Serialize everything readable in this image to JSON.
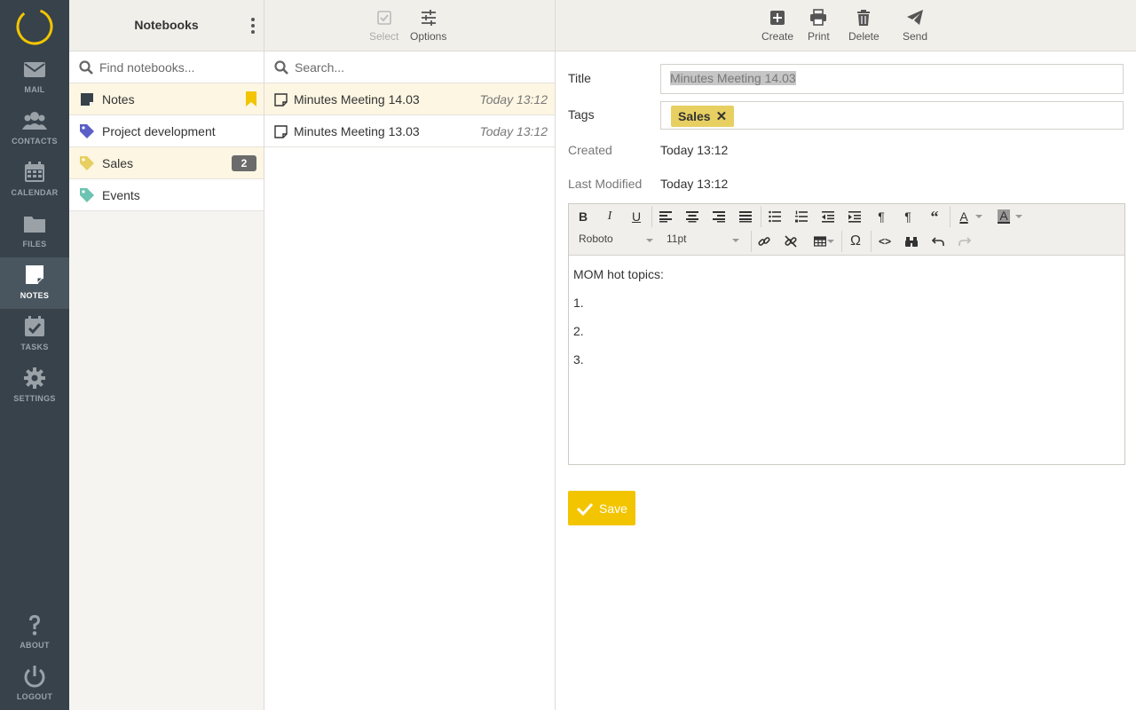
{
  "nav": {
    "items": [
      {
        "label": "MAIL",
        "icon": "mail-icon"
      },
      {
        "label": "CONTACTS",
        "icon": "contacts-icon"
      },
      {
        "label": "CALENDAR",
        "icon": "calendar-icon"
      },
      {
        "label": "FILES",
        "icon": "folder-icon"
      },
      {
        "label": "NOTES",
        "icon": "note-icon"
      },
      {
        "label": "TASKS",
        "icon": "tasks-icon"
      },
      {
        "label": "SETTINGS",
        "icon": "gear-icon"
      }
    ],
    "bottom": [
      {
        "label": "ABOUT",
        "icon": "question-icon"
      },
      {
        "label": "LOGOUT",
        "icon": "power-icon"
      }
    ],
    "active": "NOTES"
  },
  "notebooks": {
    "title": "Notebooks",
    "search_placeholder": "Find notebooks...",
    "items": [
      {
        "name": "Notes",
        "color": "#37424b"
      },
      {
        "name": "Project development",
        "color": "#5b5fc7"
      },
      {
        "name": "Sales",
        "color": "#e7cf62",
        "count": "2"
      },
      {
        "name": "Events",
        "color": "#6cc3b2"
      }
    ]
  },
  "noteslist": {
    "toolbar": {
      "select_label": "Select",
      "options_label": "Options"
    },
    "search_placeholder": "Search...",
    "notes": [
      {
        "title": "Minutes Meeting 14.03",
        "date": "Today 13:12"
      },
      {
        "title": "Minutes Meeting 13.03",
        "date": "Today 13:12"
      }
    ]
  },
  "detail": {
    "toolbar": {
      "create_label": "Create",
      "print_label": "Print",
      "delete_label": "Delete",
      "send_label": "Send"
    },
    "form": {
      "title_label": "Title",
      "title_value": "Minutes Meeting 14.03",
      "tags_label": "Tags",
      "tag": "Sales",
      "created_label": "Created",
      "created_value": "Today 13:12",
      "modified_label": "Last Modified",
      "modified_value": "Today 13:12"
    },
    "editor": {
      "font": "Roboto",
      "size": "11pt",
      "lines": [
        "MOM hot topics:",
        "1.",
        "2.",
        "3."
      ]
    },
    "save_label": "Save"
  },
  "colors": {
    "accent": "#f2c500",
    "nav_bg": "#37424b",
    "tag": "#e7cf62"
  }
}
